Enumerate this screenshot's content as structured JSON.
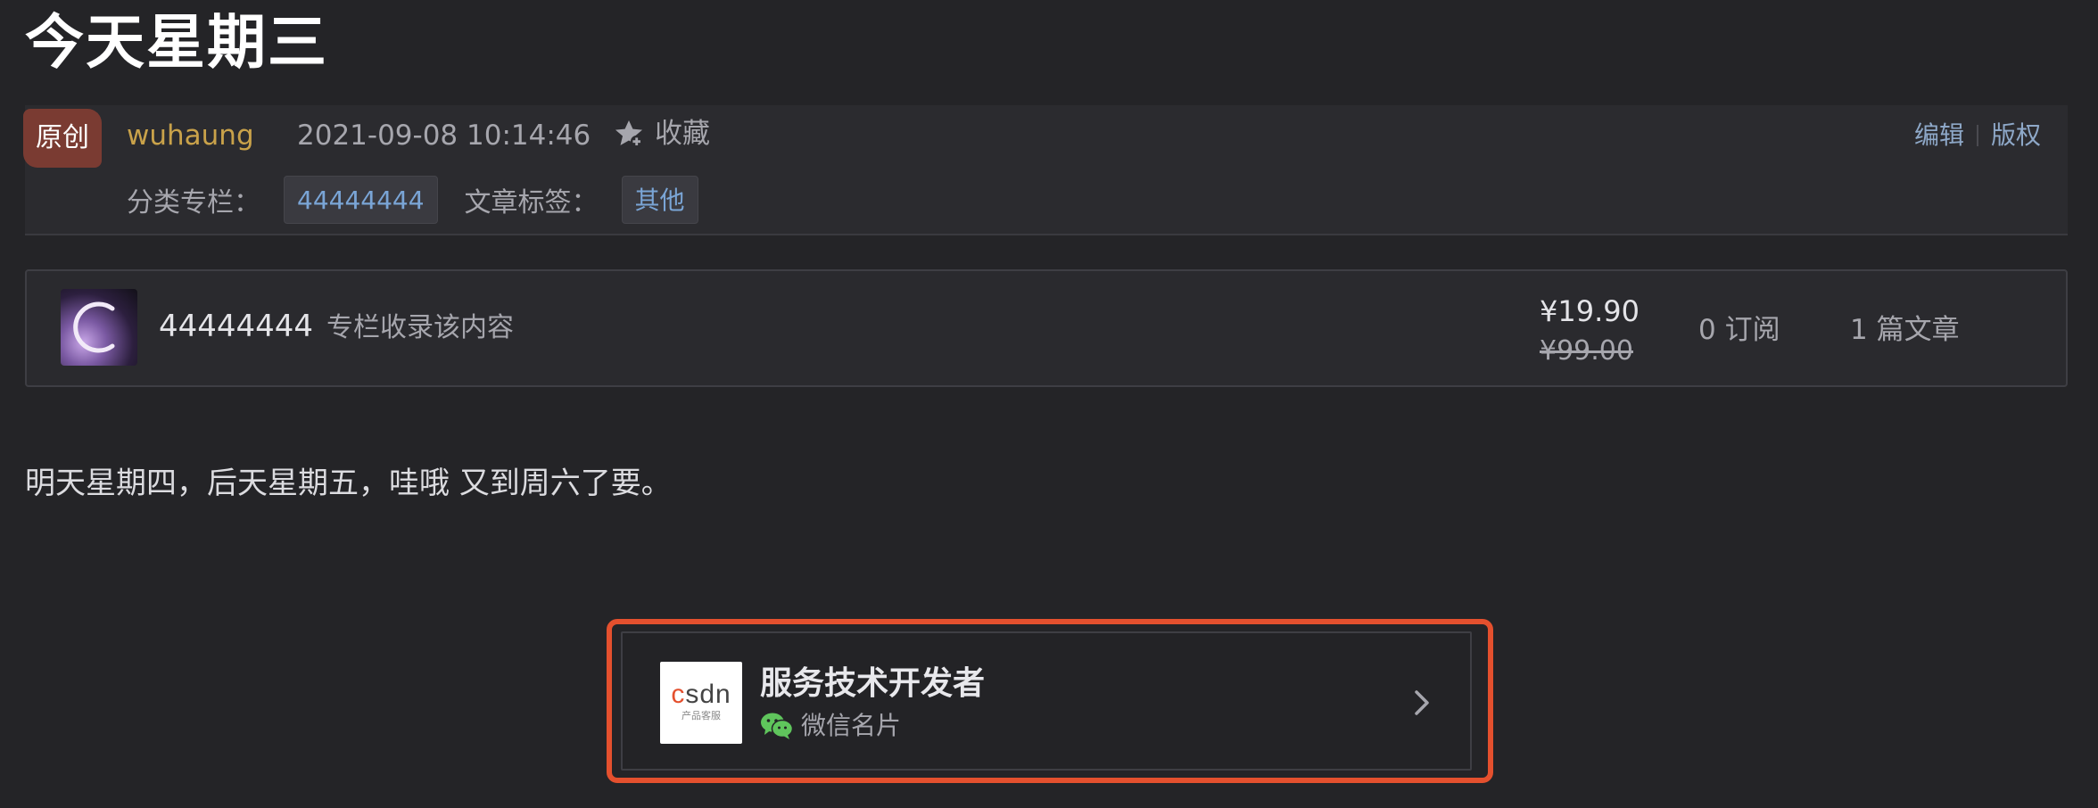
{
  "article": {
    "title": "今天星期三",
    "badge": "原创",
    "author": "wuhaung",
    "datetime": "2021-09-08 10:14:46",
    "collect_label": "收藏",
    "edit_label": "编辑",
    "copyright_label": "版权",
    "category_label": "分类专栏：",
    "category_value": "44444444",
    "tags_label": "文章标签：",
    "tag_value": "其他",
    "body": "明天星期四，后天星期五，哇哦 又到周六了要。"
  },
  "column": {
    "name": "44444444",
    "desc": "专栏收录该内容",
    "price_now": "¥19.90",
    "price_old": "¥99.00",
    "subscribers": "0 订阅",
    "articles": "1 篇文章"
  },
  "wechat_card": {
    "logo_c": "c",
    "logo_rest": "sdn",
    "logo_sub": "产品客服",
    "name": "服务技术开发者",
    "sub": "微信名片"
  },
  "colors": {
    "background": "#242427",
    "accent_red": "#e4502e",
    "author_gold": "#c9a24a",
    "link_blue": "#7aa5d6",
    "badge_brown": "#7a3b32"
  },
  "icons": {
    "collect": "star-icon",
    "wechat": "wechat-icon",
    "chevron": "chevron-right-icon"
  }
}
